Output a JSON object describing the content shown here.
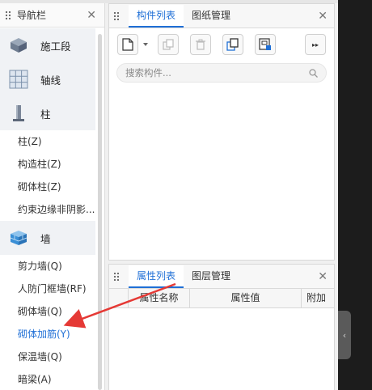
{
  "nav": {
    "title": "导航栏",
    "categories": {
      "stage": "施工段",
      "axis": "轴线",
      "column": "柱",
      "wall": "墙"
    },
    "column_items": [
      "柱(Z)",
      "构造柱(Z)",
      "砌体柱(Z)",
      "约束边缘非阴影..."
    ],
    "wall_items": [
      "剪力墙(Q)",
      "人防门框墙(RF)",
      "砌体墙(Q)",
      "砌体加筋(Y)",
      "保温墙(Q)",
      "暗梁(A)"
    ],
    "active_item": "砌体加筋(Y)"
  },
  "component_panel": {
    "tabs": [
      "构件列表",
      "图纸管理"
    ],
    "search_placeholder": "搜索构件..."
  },
  "property_panel": {
    "tabs": [
      "属性列表",
      "图层管理"
    ],
    "columns": [
      "属性名称",
      "属性值",
      "附加"
    ]
  },
  "colors": {
    "accent": "#1f6fd6",
    "arrow": "#e53935",
    "dark_area": "#1c1c1c"
  },
  "icons": [
    "grip-icon",
    "close-icon",
    "new-component-icon",
    "copy-icon",
    "delete-icon",
    "layer-copy-icon",
    "export-icon",
    "more-icon",
    "search-icon",
    "collapse-handle-icon"
  ]
}
